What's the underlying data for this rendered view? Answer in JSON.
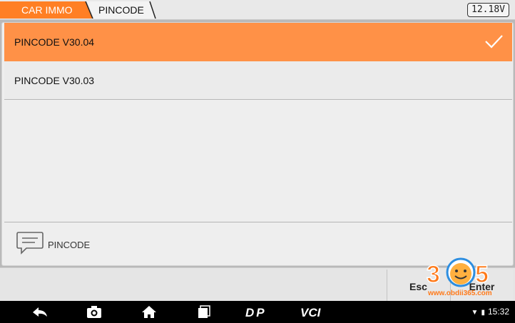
{
  "breadcrumb": {
    "home_label": "CAR IMMO",
    "current_label": "PINCODE"
  },
  "voltage": "12.18V",
  "list": {
    "items": [
      {
        "label": "PINCODE V30.04",
        "selected": true
      },
      {
        "label": "PINCODE V30.03",
        "selected": false
      }
    ]
  },
  "info": {
    "message": "PINCODE"
  },
  "buttons": {
    "esc": "Esc",
    "enter": "Enter"
  },
  "watermark": {
    "digits": "365",
    "url": "www.obdii365.com"
  },
  "status": {
    "time": "15:32"
  },
  "nav": {
    "dp_label": "DP",
    "vci_label": "VCI"
  },
  "colors": {
    "accent": "#ff9147",
    "breadcrumb_home": "#ff7f24"
  }
}
